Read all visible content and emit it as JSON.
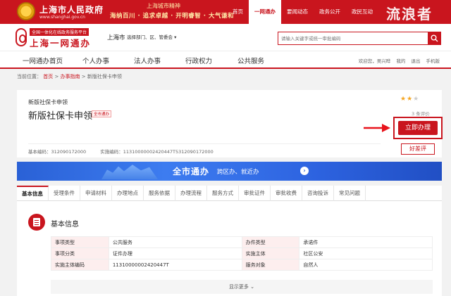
{
  "top_banner": {
    "gov_name": "上海市人民政府",
    "gov_url": "www.shanghai.gov.cn",
    "spirit_title": "上海城市精神",
    "spirit_text": "海纳百川 · 追求卓越 · 开明睿智 · 大气谦和",
    "nav": [
      "首页",
      "一网通办",
      "要闻动态",
      "政务公开",
      "政民互动"
    ],
    "nav_active": "一网通办",
    "watermark": "流浪者",
    "colors": {
      "primary": "#c9151e"
    }
  },
  "header": {
    "logo_sub": "全国一体化在线政务服务平台",
    "logo_main": "上海一网通办",
    "city": "上海市",
    "region_select": "选择部门、区、管委会 ▾",
    "search_placeholder": "请输入关键字或统一审批编码",
    "search_icon": "search-icon"
  },
  "main_nav": {
    "items": [
      "一网通办首页",
      "个人办事",
      "法人办事",
      "行政权力",
      "公共服务"
    ],
    "welcome": "欢迎您，吴兴晔",
    "user_center": "我的",
    "logout": "退出",
    "mobile": "手机版"
  },
  "breadcrumb": {
    "label": "当前位置：",
    "items": [
      "首页",
      "办事指南",
      "新版社保卡申领"
    ]
  },
  "item": {
    "small_title": "新版社保卡申领",
    "title": "新版社保卡申领",
    "badge": "全市通办",
    "rating": 2,
    "rating_max": 5,
    "review_count": "3 条评价",
    "apply_label": "立即办理",
    "review_label": "好差评",
    "basic_code": "基本编码：312090172000",
    "impl_code": "实施编码：11310000002420447T5312090172000"
  },
  "promo": {
    "main": "全市通办",
    "sub": "跨区办、就近办",
    "arrow": "›"
  },
  "tabs": [
    "基本信息",
    "受理条件",
    "申请材料",
    "办理地点",
    "服务依据",
    "办理流程",
    "服务方式",
    "审批证件",
    "审批收费",
    "咨询投诉",
    "常见问题"
  ],
  "tabs_active": 0,
  "basic_info": {
    "title": "基本信息",
    "rows": [
      [
        "事项类型",
        "公共服务",
        "办件类型",
        "承诺件"
      ],
      [
        "事项分类",
        "证件办理",
        "实施主体",
        "社区公安"
      ],
      [
        "实施主体编码",
        "11310000002420447T",
        "服务对象",
        "自然人"
      ]
    ],
    "more": "显示更多"
  }
}
